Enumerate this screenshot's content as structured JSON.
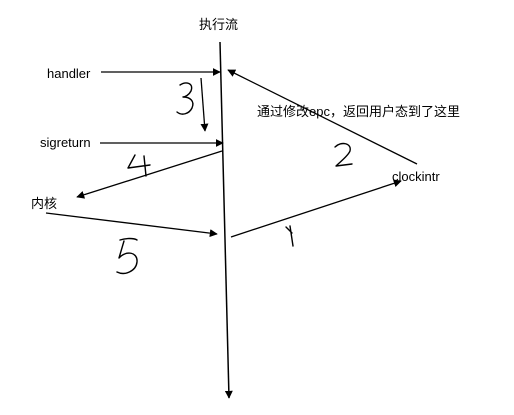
{
  "labels": {
    "title": "执行流",
    "handler": "handler",
    "sigreturn": "sigreturn",
    "kernel": "内核",
    "clockintr": "clockintr",
    "note": "通过修改epc，返回用户态到了这里"
  },
  "step_numbers": [
    "1",
    "2",
    "3",
    "4",
    "5"
  ],
  "colors": {
    "stroke": "#000000",
    "background": "#ffffff"
  }
}
